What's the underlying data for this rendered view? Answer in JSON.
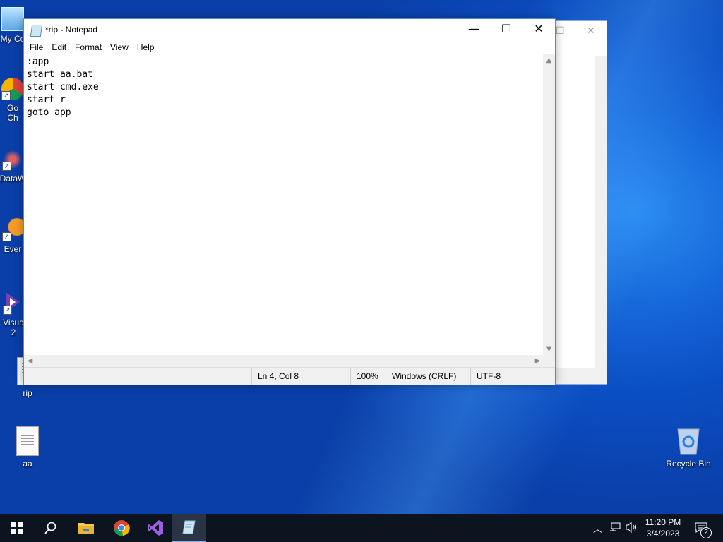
{
  "desktop": {
    "icons": [
      {
        "label": "My Co"
      },
      {
        "label": "Go\nCh"
      },
      {
        "label": "DataW"
      },
      {
        "label": "Ever"
      },
      {
        "label": "Visua\n2"
      },
      {
        "label": "rip"
      },
      {
        "label": "aa"
      },
      {
        "label": "Recycle Bin"
      }
    ]
  },
  "notepad": {
    "title": "*rip - Notepad",
    "controls": {
      "minimize": "—",
      "maximize": "☐",
      "close": "✕"
    },
    "menu": [
      "File",
      "Edit",
      "Format",
      "View",
      "Help"
    ],
    "lines": [
      ":app",
      "start aa.bat",
      "start cmd.exe",
      "start r",
      "goto app"
    ],
    "status": {
      "position": "Ln 4, Col 8",
      "zoom": "100%",
      "line_endings": "Windows (CRLF)",
      "encoding": "UTF-8"
    }
  },
  "taskbar": {
    "apps": [
      "start-button",
      "search",
      "file-explorer",
      "chrome",
      "visual-studio",
      "notepad"
    ],
    "clock": {
      "time": "11:20 PM",
      "date": "3/4/2023"
    },
    "notifications_count": "2"
  },
  "colors": {
    "desktop_blue": "#0b4fc4",
    "taskbar": "#0c1420",
    "window_border": "#5b86c9"
  }
}
